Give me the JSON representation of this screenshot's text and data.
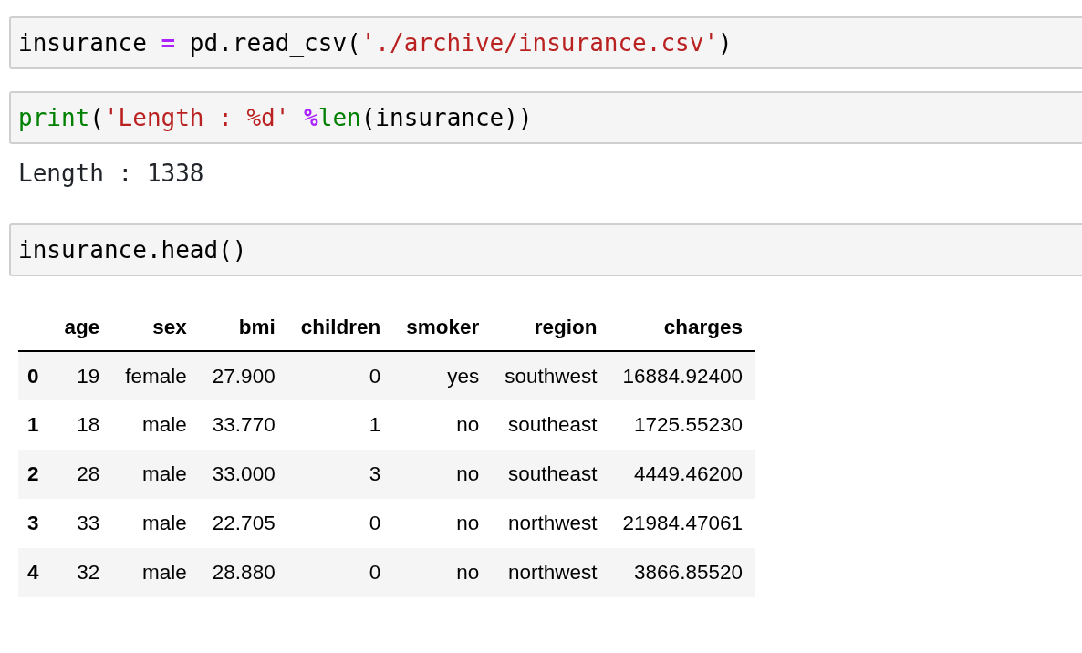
{
  "cells": [
    {
      "kind": "code",
      "tokens": [
        {
          "kind": "name",
          "text": "insurance "
        },
        {
          "kind": "operator",
          "text": "="
        },
        {
          "kind": "name",
          "text": " pd.read_csv("
        },
        {
          "kind": "string",
          "text": "'./archive/insurance.csv'"
        },
        {
          "kind": "name",
          "text": ")"
        }
      ]
    },
    {
      "kind": "code",
      "tokens": [
        {
          "kind": "builtin",
          "text": "print"
        },
        {
          "kind": "name",
          "text": "("
        },
        {
          "kind": "string",
          "text": "'Length : %d'"
        },
        {
          "kind": "operator",
          "text": " %"
        },
        {
          "kind": "builtin",
          "text": "len"
        },
        {
          "kind": "name",
          "text": "(insurance))"
        }
      ]
    },
    {
      "kind": "stream",
      "text": "Length : 1338"
    },
    {
      "kind": "code",
      "tokens": [
        {
          "kind": "name",
          "text": "insurance.head()"
        }
      ]
    },
    {
      "kind": "table",
      "columns": [
        "",
        "age",
        "sex",
        "bmi",
        "children",
        "smoker",
        "region",
        "charges"
      ],
      "rows": [
        [
          "0",
          "19",
          "female",
          "27.900",
          "0",
          "yes",
          "southwest",
          "16884.92400"
        ],
        [
          "1",
          "18",
          "male",
          "33.770",
          "1",
          "no",
          "southeast",
          "1725.55230"
        ],
        [
          "2",
          "28",
          "male",
          "33.000",
          "3",
          "no",
          "southeast",
          "4449.46200"
        ],
        [
          "3",
          "33",
          "male",
          "22.705",
          "0",
          "no",
          "northwest",
          "21984.47061"
        ],
        [
          "4",
          "32",
          "male",
          "28.880",
          "0",
          "no",
          "northwest",
          "3866.85520"
        ]
      ]
    }
  ]
}
